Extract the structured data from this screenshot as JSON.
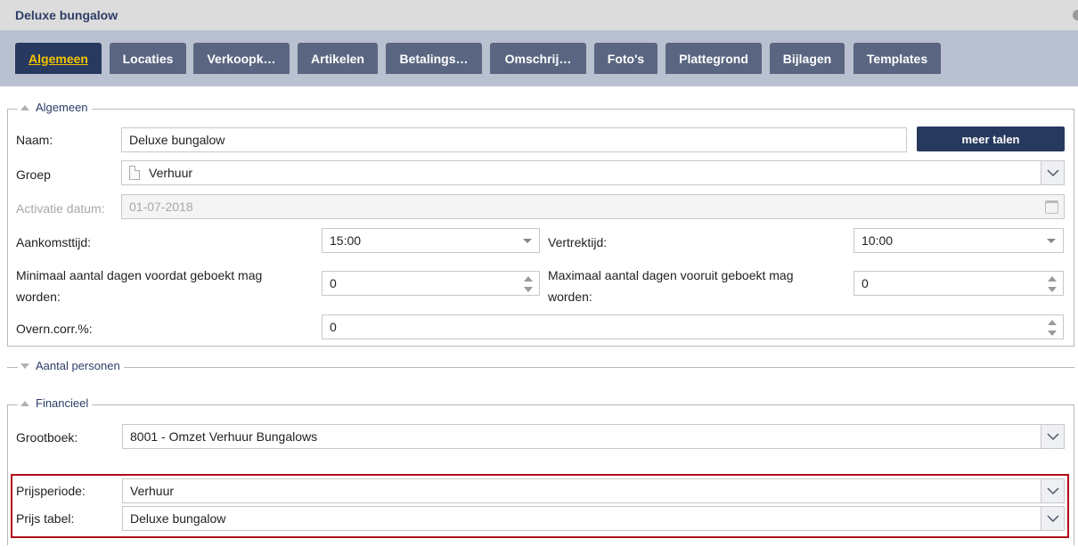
{
  "window": {
    "title": "Deluxe bungalow"
  },
  "tabs": [
    {
      "label": "Algemeen"
    },
    {
      "label": "Locaties"
    },
    {
      "label": "Verkoopk…"
    },
    {
      "label": "Artikelen"
    },
    {
      "label": "Betalings…"
    },
    {
      "label": "Omschrij…"
    },
    {
      "label": "Foto's"
    },
    {
      "label": "Plattegrond"
    },
    {
      "label": "Bijlagen"
    },
    {
      "label": "Templates"
    }
  ],
  "algemeen": {
    "legend": "Algemeen",
    "naam": {
      "label": "Naam:",
      "value": "Deluxe bungalow"
    },
    "meer_talen": "meer talen",
    "groep": {
      "label": "Groep",
      "value": "Verhuur"
    },
    "activatie": {
      "label": "Activatie datum:",
      "value": "01-07-2018"
    },
    "aankomst": {
      "label": "Aankomsttijd:",
      "value": "15:00"
    },
    "vertrek": {
      "label": "Vertrektijd:",
      "value": "10:00"
    },
    "min_dagen": {
      "label_line1": "Minimaal aantal dagen voordat geboekt mag",
      "label_line2": "worden:",
      "value": "0"
    },
    "max_dagen": {
      "label_line1": "Maximaal aantal dagen vooruit geboekt mag",
      "label_line2": "worden:",
      "value": "0"
    },
    "overn": {
      "label": "Overn.corr.%:",
      "value": "0"
    }
  },
  "aantal_personen": {
    "legend": "Aantal personen"
  },
  "financieel": {
    "legend": "Financieel",
    "grootboek": {
      "label": "Grootboek:",
      "value": "8001 - Omzet Verhuur Bungalows"
    },
    "prijsperiode": {
      "label": "Prijsperiode:",
      "value": "Verhuur"
    },
    "prijs_tabel": {
      "label": "Prijs tabel:",
      "value": "Deluxe bungalow"
    }
  },
  "colors": {
    "accent": "#27395e",
    "tab": "#5a6681",
    "active_tab_text": "#f5c400",
    "highlight": "#b00d1a"
  }
}
